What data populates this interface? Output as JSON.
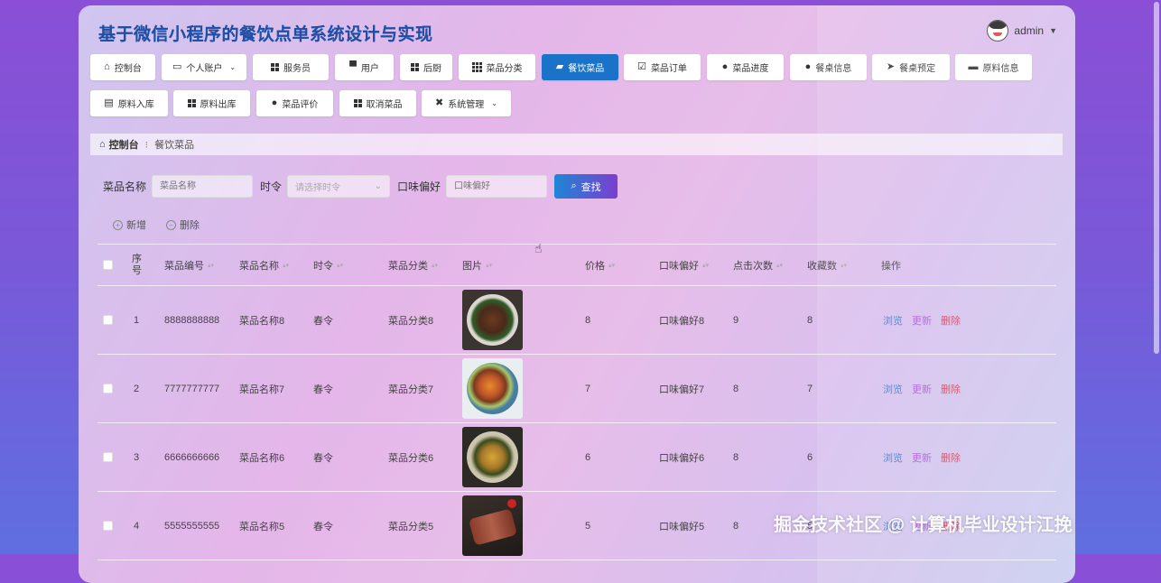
{
  "app": {
    "title": "基于微信小程序的餐饮点单系统设计与实现",
    "user": "admin"
  },
  "nav": [
    {
      "label": "控制台",
      "icon": "home-icon"
    },
    {
      "label": "个人账户",
      "icon": "account-icon",
      "dropdown": true
    },
    {
      "label": "服务员",
      "icon": "grid-icon"
    },
    {
      "label": "用户",
      "icon": "user-icon"
    },
    {
      "label": "后厨",
      "icon": "grid-icon"
    },
    {
      "label": "菜品分类",
      "icon": "grid-icon"
    },
    {
      "label": "餐饮菜品",
      "icon": "dish-icon",
      "active": true
    },
    {
      "label": "菜品订单",
      "icon": "check-icon"
    },
    {
      "label": "菜品进度",
      "icon": "pin-icon"
    },
    {
      "label": "餐桌信息",
      "icon": "user-icon"
    },
    {
      "label": "餐桌预定",
      "icon": "send-icon"
    },
    {
      "label": "原料信息",
      "icon": "monitor-icon"
    },
    {
      "label": "原料入库",
      "icon": "box-icon"
    },
    {
      "label": "原料出库",
      "icon": "grid-icon"
    },
    {
      "label": "菜品评价",
      "icon": "user-icon"
    },
    {
      "label": "取消菜品",
      "icon": "grid-icon"
    },
    {
      "label": "系统管理",
      "icon": "gear-icon",
      "dropdown": true
    }
  ],
  "breadcrumb": {
    "home": "控制台",
    "current": "餐饮菜品"
  },
  "search": {
    "name_label": "菜品名称",
    "name_placeholder": "菜品名称",
    "season_label": "时令",
    "season_placeholder": "请选择时令",
    "taste_label": "口味偏好",
    "taste_placeholder": "口味偏好",
    "button": "查找"
  },
  "actions": {
    "add": "新增",
    "delete": "删除"
  },
  "table": {
    "headers": {
      "index": "序号",
      "code": "菜品编号",
      "name": "菜品名称",
      "season": "时令",
      "category": "菜品分类",
      "image": "图片",
      "price": "价格",
      "taste": "口味偏好",
      "clicks": "点击次数",
      "favorites": "收藏数",
      "ops": "操作"
    },
    "ops": {
      "view": "浏览",
      "edit": "更新",
      "delete": "删除"
    },
    "rows": [
      {
        "index": "1",
        "code": "8888888888",
        "name": "菜品名称8",
        "season": "春令",
        "category": "菜品分类8",
        "price": "8",
        "taste": "口味偏好8",
        "clicks": "9",
        "favorites": "8"
      },
      {
        "index": "2",
        "code": "7777777777",
        "name": "菜品名称7",
        "season": "春令",
        "category": "菜品分类7",
        "price": "7",
        "taste": "口味偏好7",
        "clicks": "8",
        "favorites": "7"
      },
      {
        "index": "3",
        "code": "6666666666",
        "name": "菜品名称6",
        "season": "春令",
        "category": "菜品分类6",
        "price": "6",
        "taste": "口味偏好6",
        "clicks": "8",
        "favorites": "6"
      },
      {
        "index": "4",
        "code": "5555555555",
        "name": "菜品名称5",
        "season": "春令",
        "category": "菜品分类5",
        "price": "5",
        "taste": "口味偏好5",
        "clicks": "8",
        "favorites": "5"
      }
    ]
  },
  "watermark": "掘金技术社区 @ 计算机毕业设计江挽"
}
